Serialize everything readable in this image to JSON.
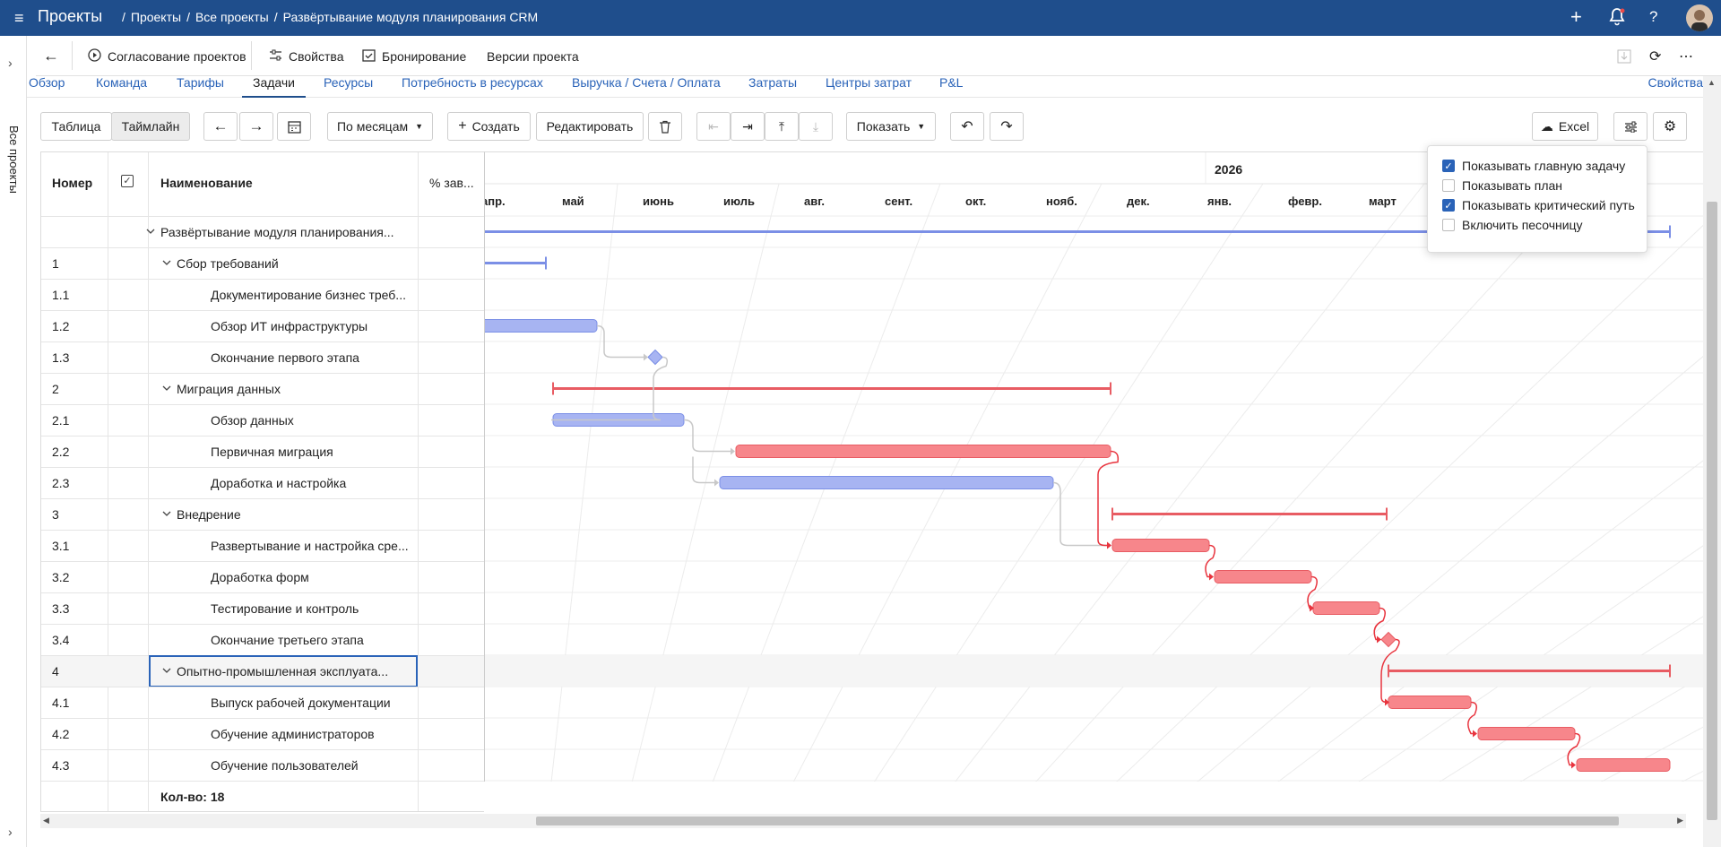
{
  "topbar": {
    "app_title": "Проекты",
    "breadcrumbs": [
      "Проекты",
      "Все проекты",
      "Развёртывание модуля планирования CRM"
    ],
    "icons": [
      "menu-icon",
      "plus-icon",
      "bell-icon",
      "help-icon",
      "avatar"
    ]
  },
  "sidebar": {
    "label": "Все проекты"
  },
  "toolbar": {
    "actions": [
      "Согласование проектов",
      "Свойства",
      "Бронирование",
      "Версии проекта"
    ]
  },
  "tabs": {
    "items": [
      "Обзор",
      "Команда",
      "Тарифы",
      "Задачи",
      "Ресурсы",
      "Потребность в ресурсах",
      "Выручка / Счета / Оплата",
      "Затраты",
      "Центры затрат",
      "P&L"
    ],
    "active": "Задачи",
    "right": "Свойства"
  },
  "view": {
    "table": "Таблица",
    "timeline": "Таймлайн",
    "scale": "По месяцам",
    "create": "Создать",
    "edit": "Редактировать",
    "show": "Показать",
    "excel": "Excel"
  },
  "grid": {
    "headers": {
      "number": "Номер",
      "name": "Наименование",
      "pct": "% зав..."
    },
    "rows": [
      {
        "num": "",
        "name": "Развёртывание модуля планирования...",
        "level": 0,
        "group": true
      },
      {
        "num": "1",
        "name": "Сбор требований",
        "level": 1,
        "group": true
      },
      {
        "num": "1.1",
        "name": "Документирование бизнес треб...",
        "level": 2,
        "group": false
      },
      {
        "num": "1.2",
        "name": "Обзор ИТ инфраструктуры",
        "level": 2,
        "group": false
      },
      {
        "num": "1.3",
        "name": "Окончание первого этапа",
        "level": 2,
        "group": false
      },
      {
        "num": "2",
        "name": "Миграция данных",
        "level": 1,
        "group": true
      },
      {
        "num": "2.1",
        "name": "Обзор данных",
        "level": 2,
        "group": false
      },
      {
        "num": "2.2",
        "name": "Первичная миграция",
        "level": 2,
        "group": false
      },
      {
        "num": "2.3",
        "name": "Доработка и настройка",
        "level": 2,
        "group": false
      },
      {
        "num": "3",
        "name": "Внедрение",
        "level": 1,
        "group": true
      },
      {
        "num": "3.1",
        "name": "Развертывание и настройка сре...",
        "level": 2,
        "group": false
      },
      {
        "num": "3.2",
        "name": "Доработка форм",
        "level": 2,
        "group": false
      },
      {
        "num": "3.3",
        "name": "Тестирование и контроль",
        "level": 2,
        "group": false
      },
      {
        "num": "3.4",
        "name": "Окончание третьего этапа",
        "level": 2,
        "group": false
      },
      {
        "num": "4",
        "name": "Опытно-промышленная эксплуата...",
        "level": 1,
        "group": true,
        "selected": true
      },
      {
        "num": "4.1",
        "name": "Выпуск рабочей документации",
        "level": 2,
        "group": false
      },
      {
        "num": "4.2",
        "name": "Обучение администраторов",
        "level": 2,
        "group": false
      },
      {
        "num": "4.3",
        "name": "Обучение пользователей",
        "level": 2,
        "group": false
      }
    ],
    "footer": "Кол-во: 18"
  },
  "timeline": {
    "year": "2026",
    "months": [
      "апр.",
      "май",
      "июнь",
      "июль",
      "авг.",
      "сент.",
      "окт.",
      "нояб.",
      "дек.",
      "янв.",
      "февр.",
      "март"
    ],
    "colors": {
      "normal": "#a7b4f2",
      "normal_border": "#7b8fe6",
      "critical": "#f7868b",
      "critical_border": "#e85c63",
      "link": "#c8c8c8",
      "critical_link": "#e8343e"
    }
  },
  "show_menu": {
    "options": [
      {
        "label": "Показывать главную задачу",
        "checked": true
      },
      {
        "label": "Показывать план",
        "checked": false
      },
      {
        "label": "Показывать критический путь",
        "checked": true
      },
      {
        "label": "Включить песочницу",
        "checked": false
      }
    ]
  }
}
